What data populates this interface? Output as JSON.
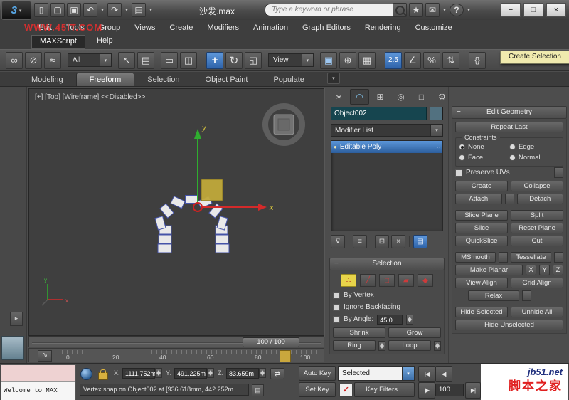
{
  "titlebar": {
    "title": "沙发.max",
    "search_placeholder": "Type a keyword or phrase"
  },
  "watermarks": {
    "top_left": "WWW.45IT.COM",
    "bottom_site": "jb51.net",
    "bottom_name": "脚本之家"
  },
  "menubar": {
    "items": [
      "Edit",
      "Tools",
      "Group",
      "Views",
      "Create",
      "Modifiers",
      "Animation",
      "Graph Editors",
      "Rendering",
      "Customize"
    ],
    "row2_maxscript": "MAXScript",
    "row2_help": "Help"
  },
  "toolbar": {
    "selection_filter": "All",
    "ref_coord": "View",
    "snap_label": "2.5",
    "tooltip": "Create Selection"
  },
  "ribbon": {
    "tabs": [
      "Modeling",
      "Freeform",
      "Selection",
      "Object Paint",
      "Populate"
    ]
  },
  "viewport": {
    "label": "[+] [Top] [Wireframe]  <<Disabled>>",
    "axis_x": "x",
    "axis_y": "y",
    "tripod_x": "x",
    "tripod_y": "y"
  },
  "timeline": {
    "slider": "100 / 100",
    "ticks": [
      "0",
      "20",
      "40",
      "60",
      "80",
      "100"
    ]
  },
  "command_panel": {
    "object_name": "Object002",
    "modifier_list": "Modifier List",
    "stack_item": "Editable Poly",
    "selection": {
      "title": "Selection",
      "by_vertex": "By Vertex",
      "ignore_backfacing": "Ignore Backfacing",
      "by_angle": "By Angle:",
      "angle_value": "45.0",
      "shrink": "Shrink",
      "grow": "Grow",
      "ring": "Ring",
      "loop": "Loop"
    }
  },
  "edit_geometry": {
    "title": "Edit Geometry",
    "repeat_last": "Repeat Last",
    "constraints_title": "Constraints",
    "constraint_none": "None",
    "constraint_edge": "Edge",
    "constraint_face": "Face",
    "constraint_normal": "Normal",
    "preserve_uvs": "Preserve UVs",
    "create": "Create",
    "collapse": "Collapse",
    "attach": "Attach",
    "detach": "Detach",
    "slice_plane": "Slice Plane",
    "split": "Split",
    "slice": "Slice",
    "reset_plane": "Reset Plane",
    "quickslice": "QuickSlice",
    "cut": "Cut",
    "msmooth": "MSmooth",
    "tessellate": "Tessellate",
    "make_planar": "Make Planar",
    "axis_x": "X",
    "axis_y": "Y",
    "axis_z": "Z",
    "view_align": "View Align",
    "grid_align": "Grid Align",
    "relax": "Relax",
    "hide_selected": "Hide Selected",
    "unhide_all": "Unhide All",
    "hide_unselected": "Hide Unselected"
  },
  "statusbar": {
    "listener_input": "Welcome to MAX",
    "prompt": "Vertex snap on Object002 at [936.618mm, 442.252m",
    "x_label": "X:",
    "x_value": "1111.752m",
    "y_label": "Y:",
    "y_value": "491.225m",
    "z_label": "Z:",
    "z_value": "83.659m",
    "auto_key": "Auto Key",
    "set_key": "Set Key",
    "key_filter_mode": "Selected",
    "key_filters": "Key Filters...",
    "frame": "100"
  },
  "icons": {
    "logo_glyph": "3",
    "caret_down": "▾",
    "minus": "−",
    "window_max": "□",
    "window_close": "×",
    "new_file": "▯",
    "open_file": "▢",
    "save_file": "▣",
    "undo": "↶",
    "redo": "↷",
    "workspace": "▤",
    "star": "★",
    "mail": "✉",
    "help": "?",
    "link": "∞",
    "unlink": "⊘",
    "bind_spacewarp": "≈",
    "select_cursor": "↖",
    "select_by_name": "▤",
    "region_rect": "▭",
    "window_crossing": "◫",
    "move": "+",
    "rotate": "↻",
    "scale": "◱",
    "use_center": "▣",
    "manipulate": "⊕",
    "keyboard_override": "▦",
    "angle_snap": "∠",
    "percent_snap": "%",
    "spinner_snap": "⇅",
    "named_sets": "{}",
    "tab_create": "∗",
    "tab_modify": "◠",
    "tab_hierarchy": "⊞",
    "tab_motion": "◎",
    "tab_display": "□",
    "tab_utilities": "⚙",
    "bulb": "●",
    "stack_dots": "∙∙",
    "pin_stack": "⊽",
    "show_end_result": "≡",
    "make_unique": "⊡",
    "remove_modifier": "×",
    "configure_sets": "▤",
    "so_vertex": "∴",
    "so_edge": "╱",
    "so_border": "□",
    "so_polygon": "▰",
    "so_element": "◆",
    "curve_editor_mini": "∿",
    "layout_arrow": "▸",
    "offset_mode": "⇄",
    "prompt_note": "▤",
    "setkeys_check": "✓",
    "goto_start": "|◀",
    "prev_frame": "◀|",
    "next_frame": "|▶",
    "goto_end": "▶|"
  }
}
